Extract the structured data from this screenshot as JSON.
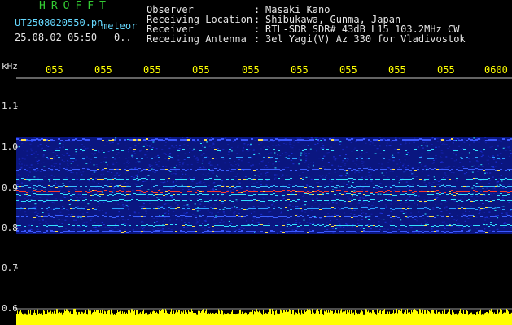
{
  "header": {
    "app_title": "HROFFT",
    "file_name": "UT2508020550.pn",
    "file_suffix": "meteor",
    "date_time": "25.08.02 05:50",
    "counter": "0..",
    "info": [
      {
        "label": "Observer",
        "value": "Masaki Kano"
      },
      {
        "label": "Receiving Location",
        "value": "Shibukawa, Gunma, Japan"
      },
      {
        "label": "Receiver",
        "value": "RTL-SDR SDR# 43dB L15 103.2MHz CW"
      },
      {
        "label": "Receiving Antenna",
        "value": "3el Yagi(V) Az 330 for Vladivostok"
      }
    ],
    "separator": ":"
  },
  "axis": {
    "unit": "kHz",
    "y_labels": [
      "1.1",
      "1.0",
      "0.9",
      "0.8",
      "0.7",
      "0.6"
    ],
    "x_ticks": [
      "055",
      "055",
      "055",
      "055",
      "055",
      "055",
      "055",
      "055",
      "055",
      "0600"
    ]
  },
  "colors": {
    "background": "#000000",
    "noise_blue": "#1a2fd6",
    "signal_cyan": "#33e0ff",
    "signal_red": "#ff3a2a",
    "power_yellow": "#ffff00",
    "grid": "#c8c8c8"
  }
}
